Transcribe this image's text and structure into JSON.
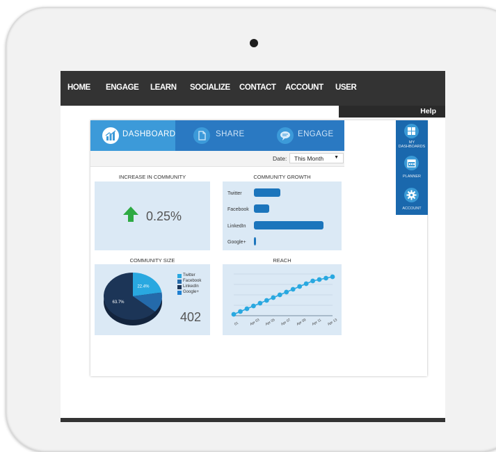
{
  "nav": {
    "items": [
      {
        "label": "HOME"
      },
      {
        "label": "ENGAGE"
      },
      {
        "label": "LEARN"
      },
      {
        "label": "SOCIALIZE"
      },
      {
        "label": "CONTACT"
      },
      {
        "label": "ACCOUNT"
      },
      {
        "label": "USER"
      }
    ],
    "help_label": "Help"
  },
  "tabs": [
    {
      "label": "DASHBOARD",
      "icon": "chart-icon"
    },
    {
      "label": "SHARE",
      "icon": "document-icon"
    },
    {
      "label": "ENGAGE",
      "icon": "chat-bubble-icon"
    }
  ],
  "date_filter": {
    "label": "Date:",
    "value": "This Month"
  },
  "panels": {
    "increase": {
      "title": "INCREASE IN COMMUNITY",
      "value": "0.25%",
      "trend": "up",
      "color": "#2eaa43"
    },
    "growth": {
      "title": "COMMUNITY GROWTH"
    },
    "size": {
      "title": "COMMUNITY SIZE",
      "total": "402",
      "pie_labels": [
        "22.4%",
        "63.7%"
      ]
    },
    "reach": {
      "title": "REACH"
    }
  },
  "sidebar": {
    "items": [
      {
        "label": "MY DASHBOARDS",
        "icon": "grid-icon"
      },
      {
        "label": "PLANNER",
        "icon": "calendar-icon"
      },
      {
        "label": "ACCOUNT",
        "icon": "gear-icon"
      }
    ]
  },
  "colors": {
    "accent": "#1c75bc",
    "active_tab": "#3c9ad9",
    "tab_bar": "#2a79c2",
    "panel_bg": "#dbe9f5",
    "nav_bg": "#333333"
  },
  "chart_data": [
    {
      "type": "bar",
      "orientation": "horizontal",
      "title": "COMMUNITY GROWTH",
      "categories": [
        "Twitter",
        "Facebook",
        "LinkedIn",
        "Google+"
      ],
      "values": [
        38,
        22,
        100,
        3
      ]
    },
    {
      "type": "pie",
      "title": "COMMUNITY SIZE",
      "categories": [
        "Twitter",
        "Facebook",
        "LinkedIn",
        "Google+"
      ],
      "values": [
        22.4,
        13.9,
        63.7,
        0.0
      ],
      "colors": [
        "#29a8e0",
        "#246aaa",
        "#1c3557",
        "#1f7fd1"
      ],
      "data_labels": [
        "22.4%",
        "",
        "63.7%",
        ""
      ],
      "legend_placement": "top-right"
    },
    {
      "type": "line",
      "title": "REACH",
      "x": [
        "01",
        "Apr 03",
        "Apr 05",
        "Apr 07",
        "Apr 09",
        "Apr 11",
        "Apr 13"
      ],
      "values": [
        1,
        3,
        5,
        7,
        9,
        11,
        13,
        15,
        17,
        19,
        21,
        23,
        25,
        26,
        27,
        28
      ],
      "grid": true
    }
  ]
}
